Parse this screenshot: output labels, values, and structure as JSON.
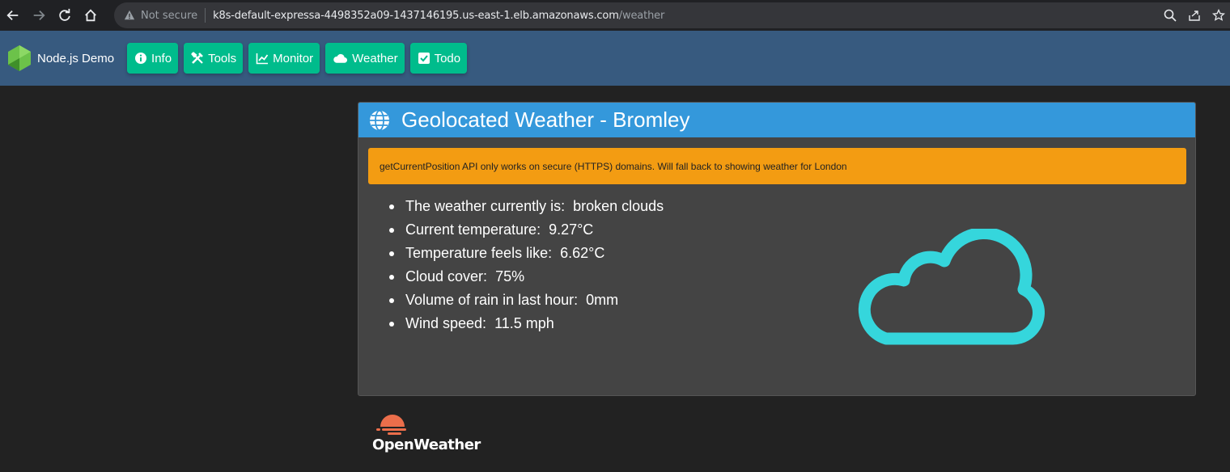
{
  "browser": {
    "not_secure": "Not secure",
    "url_host": "k8s-default-expressa-4498352a09-1437146195.us-east-1.elb.amazonaws.com",
    "url_path": "/weather"
  },
  "navbar": {
    "brand": "Node.js Demo",
    "items": [
      {
        "label": "Info",
        "icon": "info-circle-icon"
      },
      {
        "label": "Tools",
        "icon": "tools-icon"
      },
      {
        "label": "Monitor",
        "icon": "chart-line-icon"
      },
      {
        "label": "Weather",
        "icon": "cloud-icon"
      },
      {
        "label": "Todo",
        "icon": "check-square-icon"
      }
    ],
    "colors": {
      "bar": "#375a7f",
      "button": "#00bc8c"
    }
  },
  "card": {
    "title": "Geolocated Weather - Bromley",
    "alert": "getCurrentPosition API only works on secure (HTTPS) domains. Will fall back to showing weather for London",
    "items": [
      {
        "label": "The weather currently is:",
        "value": "broken clouds"
      },
      {
        "label": "Current temperature:",
        "value": "9.27°C"
      },
      {
        "label": "Temperature feels like:",
        "value": "6.62°C"
      },
      {
        "label": "Cloud cover:",
        "value": "75%"
      },
      {
        "label": "Volume of rain in last hour:",
        "value": "0mm"
      },
      {
        "label": "Wind speed:",
        "value": "11.5 mph"
      }
    ],
    "colors": {
      "header": "#3498db",
      "alert": "#f39c12",
      "icon": "#35d6dc"
    },
    "weather_icon": "cloud-icon"
  },
  "footer": {
    "logo_text": "OpenWeather"
  }
}
